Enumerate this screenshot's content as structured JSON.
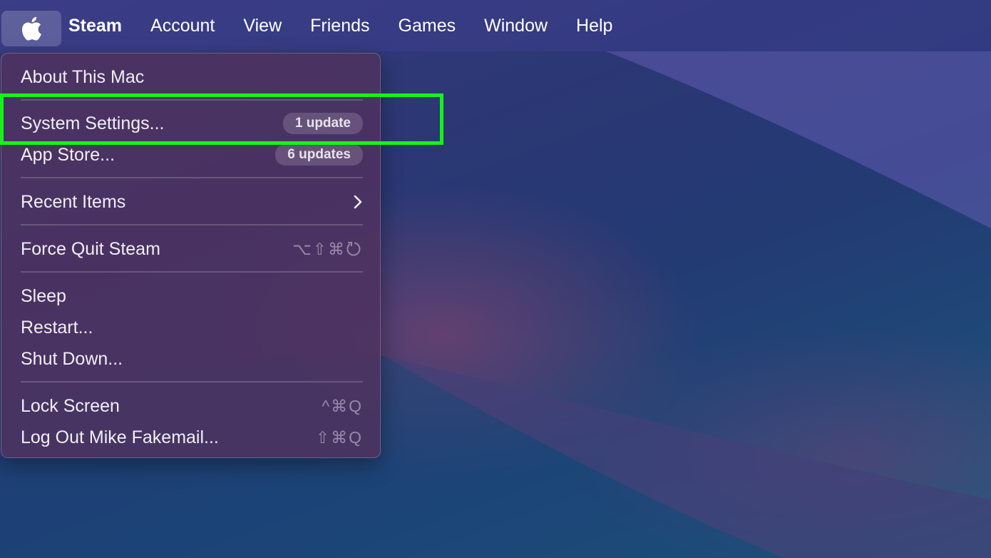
{
  "menubar": {
    "apple_icon": "apple-logo-icon",
    "app_name": "Steam",
    "items": [
      "Account",
      "View",
      "Friends",
      "Games",
      "Window",
      "Help"
    ]
  },
  "apple_menu": {
    "about": "About This Mac",
    "system_settings": {
      "label": "System Settings...",
      "badge": "1 update"
    },
    "app_store": {
      "label": "App Store...",
      "badge": "6 updates"
    },
    "recent_items": {
      "label": "Recent Items",
      "icon": "chevron-right-icon"
    },
    "force_quit": {
      "label": "Force Quit Steam",
      "shortcut": "⌥⇧⌘",
      "shortcut_icon": "power-escape-icon"
    },
    "sleep": "Sleep",
    "restart": "Restart...",
    "shut_down": "Shut Down...",
    "lock_screen": {
      "label": "Lock Screen",
      "shortcut": "^⌘Q"
    },
    "log_out": {
      "label": "Log Out Mike Fakemail...",
      "shortcut": "⇧⌘Q"
    }
  },
  "colors": {
    "highlight": "#19f21a",
    "menu_bg": "#4e3260",
    "menubar_bg": "#3c3e8c"
  }
}
